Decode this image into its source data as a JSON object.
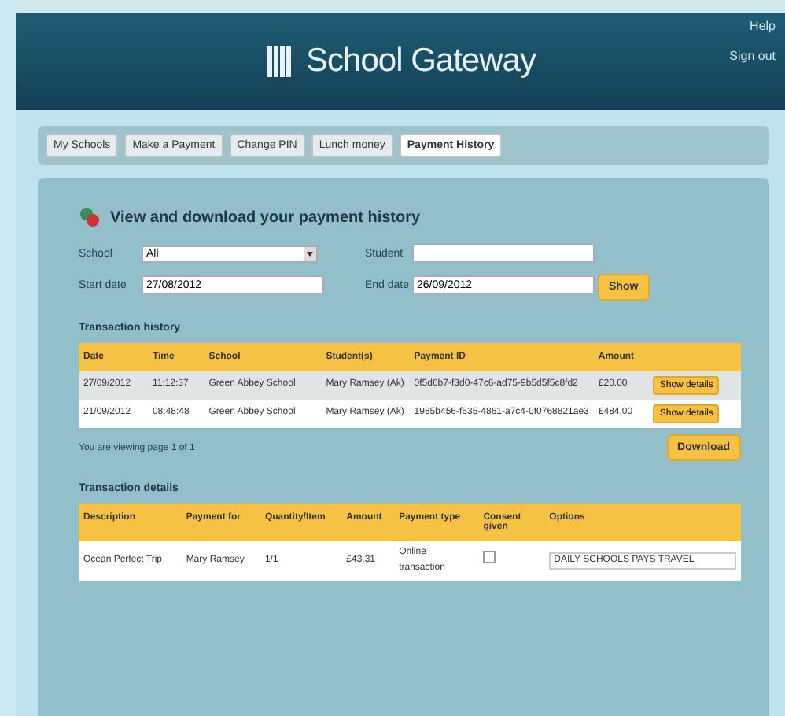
{
  "header": {
    "title": "School Gateway",
    "links": [
      "Help",
      "Sign out"
    ]
  },
  "tabs": [
    {
      "label": "My Schools",
      "selected": false
    },
    {
      "label": "Make a Payment",
      "selected": false
    },
    {
      "label": "Change PIN",
      "selected": false
    },
    {
      "label": "Lunch money",
      "selected": false
    },
    {
      "label": "Payment History",
      "selected": true
    }
  ],
  "panel_title": "View and download your payment history",
  "filters": {
    "school_label": "School",
    "school_value": "All",
    "student_label": "Student",
    "start_label": "Start date",
    "start_value": "27/08/2012",
    "end_label": "End date",
    "end_value": "26/09/2012",
    "show_button": "Show"
  },
  "history": {
    "title": "Transaction history",
    "columns": [
      "Date",
      "Time",
      "School",
      "Student(s)",
      "Payment ID",
      "Amount"
    ],
    "rows": [
      {
        "cells": [
          "27/09/2012",
          "11:12:37",
          "Green Abbey School",
          "Mary Ramsey (Ak)",
          "0f5d6b7-f3d0-47c6-ad75-9b5d5f5c8fd2",
          "£20.00"
        ],
        "button": "Show details",
        "selected": true
      },
      {
        "cells": [
          "21/09/2012",
          "08:48:48",
          "Green Abbey School",
          "Mary Ramsey (Ak)",
          "1985b456-f635-4861-a7c4-0f0768821ae3",
          "£484.00"
        ],
        "button": "Show details",
        "selected": false
      }
    ],
    "paging": "You are viewing page 1 of 1",
    "download_button": "Download"
  },
  "details": {
    "title": "Transaction details",
    "columns": [
      "Description",
      "Payment for",
      "Quantity/Item",
      "Amount",
      "Payment type",
      "Consent given",
      "Options"
    ],
    "rows": [
      {
        "cells": [
          "Ocean Perfect Trip",
          "Mary Ramsey",
          "1/1",
          "£43.31",
          "Online transaction"
        ],
        "consent": false,
        "options": "DAILY SCHOOLS PAYS TRAVEL"
      }
    ]
  }
}
